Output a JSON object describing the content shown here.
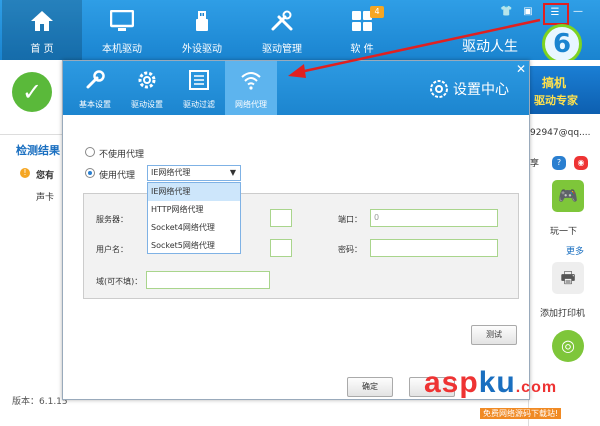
{
  "topbar": {
    "nav": [
      {
        "label": "首 页",
        "icon": "home-icon"
      },
      {
        "label": "本机驱动",
        "icon": "monitor-icon"
      },
      {
        "label": "外设驱动",
        "icon": "usb-icon"
      },
      {
        "label": "驱动管理",
        "icon": "tools-icon"
      },
      {
        "label": "软 件",
        "icon": "apps-icon",
        "badge": "4"
      }
    ],
    "brand": "驱动人生",
    "logo_text": "6",
    "controls": {
      "menu": "☰",
      "minimize": "—"
    }
  },
  "background": {
    "check": "✓",
    "detect_title": "检测结果",
    "warn_icon": "!",
    "warn_text": "您有",
    "sound_card": "声卡",
    "version": "版本：6.1.15"
  },
  "right_panel": {
    "ad_line1": "搞机",
    "ad_line2": "驱动专家",
    "account": "92947@qq....",
    "share": "享",
    "game_label": "玩一下",
    "more": "更多",
    "printer_label": "添加打印机"
  },
  "dialog": {
    "title": "设置中心",
    "close": "✕",
    "tabs": [
      {
        "label": "基本设置",
        "icon": "wrench-icon"
      },
      {
        "label": "驱动设置",
        "icon": "gear-icon"
      },
      {
        "label": "驱动过滤",
        "icon": "list-icon"
      },
      {
        "label": "网络代理",
        "icon": "wifi-icon"
      }
    ],
    "no_proxy_label": "不使用代理",
    "use_proxy_label": "使用代理",
    "proxy_select": {
      "value": "IE网络代理",
      "options": [
        "IE网络代理",
        "HTTP网络代理",
        "Socket4网络代理",
        "Socket5网络代理"
      ]
    },
    "fields": {
      "server_label": "服务器：",
      "port_label": "端口：",
      "port_value": "0",
      "username_label": "用户名：",
      "password_label": "密码：",
      "domain_label": "域(可不填)："
    },
    "test_button": "测试",
    "ok_button": "确定"
  },
  "watermark": {
    "asp": "asp",
    "ku": "ku",
    "com": ".com",
    "sub": "免费网络源码下载站!"
  },
  "colors": {
    "topbar": "#1a84d0",
    "accent_green": "#5ab93a",
    "highlight_red": "#e02020"
  }
}
